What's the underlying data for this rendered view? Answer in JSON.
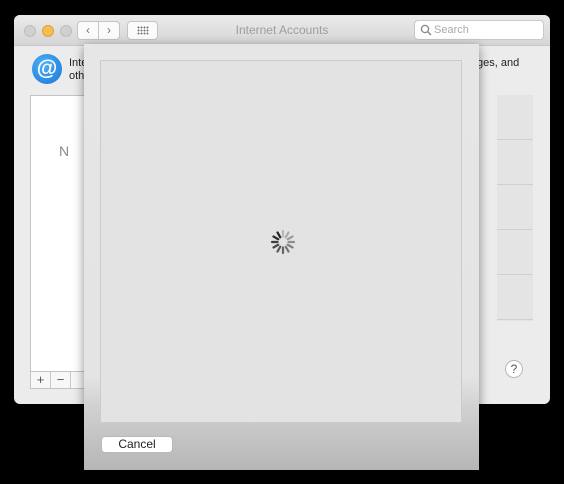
{
  "window": {
    "title": "Internet Accounts",
    "search_placeholder": "Search"
  },
  "nav": {
    "back_glyph": "‹",
    "forward_glyph": "›"
  },
  "header": {
    "icon_glyph": "@",
    "description_left": "Inte\noth",
    "description_right": "ges, and"
  },
  "accounts_list": {
    "empty_text_fragment": "N",
    "add_label": "+",
    "remove_label": "−"
  },
  "help_label": "?",
  "sheet": {
    "cancel_label": "Cancel",
    "loading": true
  },
  "colors": {
    "minimize": "#f5be4f",
    "accent_blue": "#1676d7"
  },
  "icons": [
    "close-light-icon",
    "minimize-light-icon",
    "zoom-light-icon",
    "chevron-left-icon",
    "chevron-right-icon",
    "grid-icon",
    "search-icon",
    "at-sign-icon",
    "help-icon",
    "spinner-icon"
  ]
}
